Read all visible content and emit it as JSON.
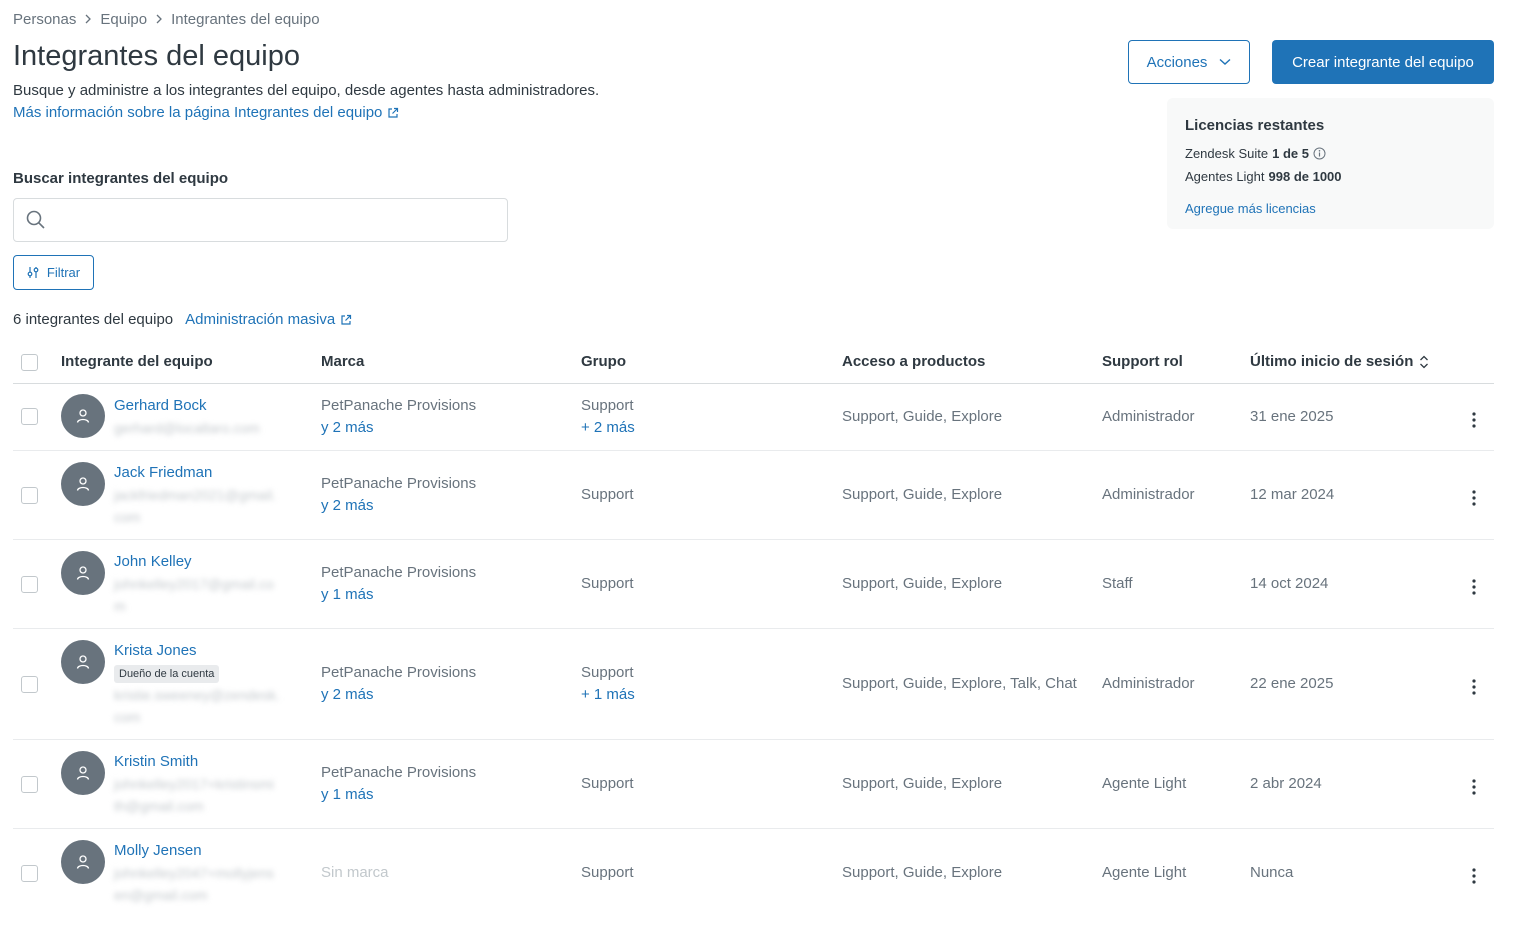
{
  "breadcrumb": [
    "Personas",
    "Equipo",
    "Integrantes del equipo"
  ],
  "header": {
    "title": "Integrantes del equipo",
    "description": "Busque y administre a los integrantes del equipo, desde agentes hasta administradores.",
    "learn_link": "Más información sobre la página Integrantes del equipo"
  },
  "toolbar": {
    "actions_label": "Acciones",
    "create_label": "Crear integrante del equipo"
  },
  "licenses": {
    "title": "Licencias restantes",
    "items": [
      {
        "label": "Zendesk Suite",
        "value": "1 de 5"
      },
      {
        "label": "Agentes Light",
        "value": "998 de 1000"
      }
    ],
    "add_link": "Agregue más licencias"
  },
  "search": {
    "label": "Buscar integrantes del equipo",
    "value": "",
    "placeholder": ""
  },
  "filter_label": "Filtrar",
  "count_text": "6 integrantes del equipo",
  "bulk_link": "Administración masiva",
  "columns": [
    "Integrante del equipo",
    "Marca",
    "Grupo",
    "Acceso a productos",
    "Support rol",
    "Último inicio de sesión"
  ],
  "rows": [
    {
      "name": "Gerhard Bock",
      "email": [
        "gerhard@localtaro.com"
      ],
      "badge": "",
      "brand": "PetPanache Provisions",
      "brand_more": "y 2 más",
      "group": "Support",
      "group_more": "+ 2 más",
      "products": "Support, Guide, Explore",
      "role": "Administrador",
      "last_login": "31 ene 2025"
    },
    {
      "name": "Jack Friedman",
      "email": [
        "jackfriedman2021@gmail.",
        "com"
      ],
      "badge": "",
      "brand": "PetPanache Provisions",
      "brand_more": "y 2 más",
      "group": "Support",
      "group_more": "",
      "products": "Support, Guide, Explore",
      "role": "Administrador",
      "last_login": "12 mar 2024"
    },
    {
      "name": "John Kelley",
      "email": [
        "johnkelley2017@gmail.co",
        "m"
      ],
      "badge": "",
      "brand": "PetPanache Provisions",
      "brand_more": "y 1 más",
      "group": "Support",
      "group_more": "",
      "products": "Support, Guide, Explore",
      "role": "Staff",
      "last_login": "14 oct 2024"
    },
    {
      "name": "Krista Jones",
      "email": [
        "kristie.sweeney@zendesk.",
        "com"
      ],
      "badge": "Dueño de la cuenta",
      "brand": "PetPanache Provisions",
      "brand_more": "y 2 más",
      "group": "Support",
      "group_more": "+ 1 más",
      "products": "Support, Guide, Explore, Talk, Chat",
      "role": "Administrador",
      "last_login": "22 ene 2025"
    },
    {
      "name": "Kristin Smith",
      "email": [
        "johnkelley2017+kristinsmi",
        "th@gmail.com"
      ],
      "badge": "",
      "brand": "PetPanache Provisions",
      "brand_more": "y 1 más",
      "group": "Support",
      "group_more": "",
      "products": "Support, Guide, Explore",
      "role": "Agente Light",
      "last_login": "2 abr 2024"
    },
    {
      "name": "Molly Jensen",
      "email": [
        "johnkelley2047+mollyjens",
        "en@gmail.com"
      ],
      "badge": "",
      "brand": "Sin marca",
      "brand_more": "",
      "brand_muted": true,
      "group": "Support",
      "group_more": "",
      "products": "Support, Guide, Explore",
      "role": "Agente Light",
      "last_login": "Nunca"
    }
  ]
}
